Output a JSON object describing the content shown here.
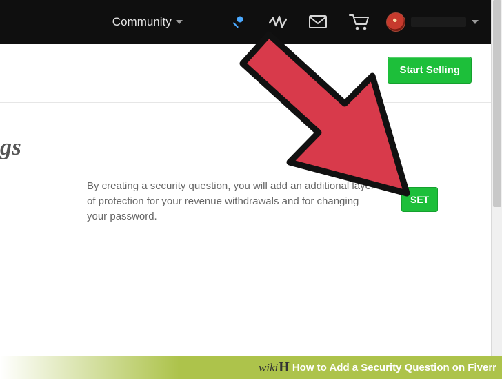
{
  "topbar": {
    "community_label": "Community"
  },
  "header": {
    "start_selling_label": "Start Selling"
  },
  "page": {
    "heading_fragment": "gs"
  },
  "security": {
    "description": "By creating a security question, you will add an additional layer of protection for your revenue withdrawals and for changing your password.",
    "set_label": "SET"
  },
  "footer": {
    "article_title": "How to Add a Security Question on Fiverr"
  }
}
